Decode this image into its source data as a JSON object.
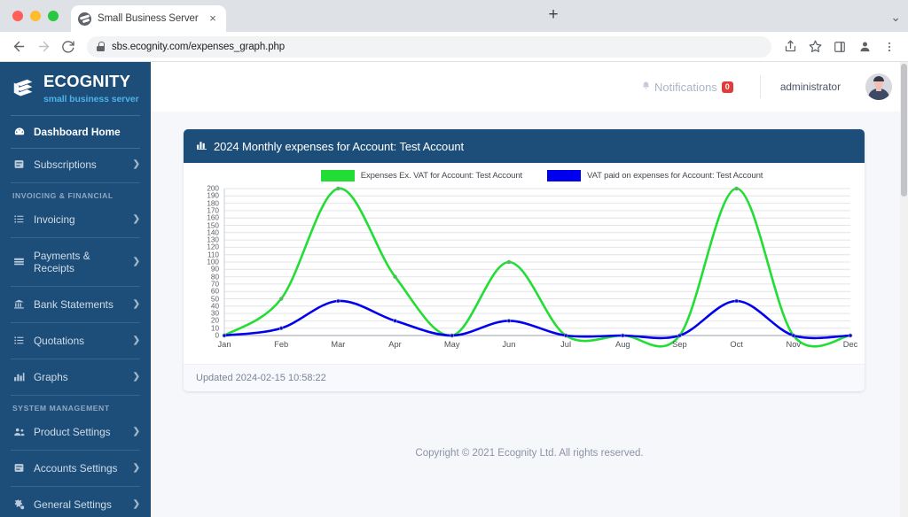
{
  "browser": {
    "tab": {
      "title": "Small Business Server - Dashb",
      "favicon": "globe-icon",
      "close": "×"
    },
    "new_tab_label": "+",
    "tabstrip_menu": "⌄",
    "nav": {
      "back": "←",
      "forward": "→",
      "reload": "↻"
    },
    "url": "sbs.ecognity.com/expenses_graph.php",
    "actions": [
      "share-icon",
      "bookmark-star-icon",
      "side-panel-icon",
      "profile-icon",
      "browser-menu-icon"
    ]
  },
  "sidebar": {
    "brand_name": "ECOGNITY",
    "brand_sub": "small business server",
    "home": {
      "label": "Dashboard Home",
      "icon": "dashboard-icon"
    },
    "items": [
      {
        "label": "Subscriptions",
        "icon": "card-icon",
        "chevron": "❯"
      },
      {
        "label": "Invoicing",
        "icon": "list-icon",
        "chevron": "❯"
      },
      {
        "label": "Payments & Receipts",
        "icon": "payments-icon",
        "chevron": "❯"
      },
      {
        "label": "Bank Statements",
        "icon": "bank-icon",
        "chevron": "❯"
      },
      {
        "label": "Quotations",
        "icon": "list-icon",
        "chevron": "❯"
      },
      {
        "label": "Graphs",
        "icon": "chart-icon",
        "chevron": "❯"
      },
      {
        "label": "Product Settings",
        "icon": "people-icon",
        "chevron": "❯"
      },
      {
        "label": "Accounts Settings",
        "icon": "card-icon",
        "chevron": "❯"
      },
      {
        "label": "General Settings",
        "icon": "gears-icon",
        "chevron": "❯"
      }
    ],
    "headings": {
      "invoicing": "INVOICING & FINANCIAL",
      "system": "SYSTEM MANAGEMENT"
    }
  },
  "topbar": {
    "notifications_label": "Notifications",
    "notifications_count": "0",
    "bell_icon": "bell-icon",
    "username": "administrator",
    "avatar": "user-avatar"
  },
  "card": {
    "title": "2024 Monthly expenses for Account: Test Account",
    "title_icon": "bar-chart-icon",
    "updated": "Updated 2024-02-15 10:58:22"
  },
  "footer": {
    "copyright": "Copyright © 2021 Ecognity Ltd. All rights reserved."
  },
  "colors": {
    "sidebar": "#1d4e79",
    "card_header": "#1d4e79",
    "series_green": "#22dd33",
    "series_blue": "#0000ee",
    "badge_red": "#e13b3b",
    "brand_sub": "#4db1e8"
  },
  "chart_data": {
    "type": "line",
    "title": "2024 Monthly expenses for Account: Test Account",
    "xlabel": "",
    "ylabel": "",
    "ylim": [
      0,
      200
    ],
    "ytick_step": 10,
    "yticks": [
      0,
      10,
      20,
      30,
      40,
      50,
      60,
      70,
      80,
      90,
      100,
      110,
      120,
      130,
      140,
      150,
      160,
      170,
      180,
      190,
      200
    ],
    "categories": [
      "Jan",
      "Feb",
      "Mar",
      "Apr",
      "May",
      "Jun",
      "Jul",
      "Aug",
      "Sep",
      "Oct",
      "Nov",
      "Dec"
    ],
    "grid": true,
    "legend_position": "top",
    "smoothing": "spline",
    "series": [
      {
        "name": "Expenses Ex. VAT for Account: Test Account",
        "color": "#22dd33",
        "values": [
          0,
          50,
          200,
          80,
          0,
          100,
          0,
          0,
          0,
          200,
          0,
          0
        ]
      },
      {
        "name": "VAT paid on expenses for Account: Test Account",
        "color": "#0000ee",
        "values": [
          0,
          10,
          47,
          20,
          0,
          20,
          0,
          0,
          0,
          47,
          0,
          0
        ]
      }
    ]
  }
}
